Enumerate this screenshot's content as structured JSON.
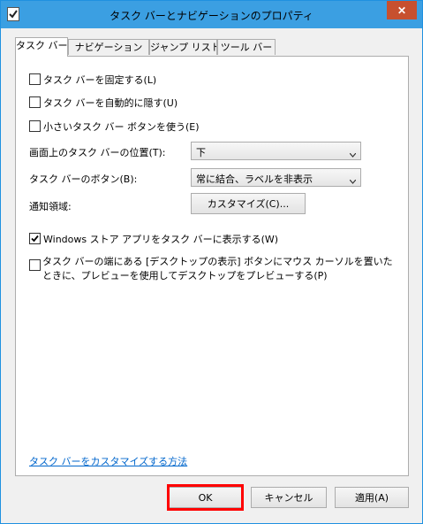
{
  "window": {
    "title": "タスク バーとナビゲーションのプロパティ",
    "close_glyph": "✕"
  },
  "tabs": [
    {
      "label": "タスク バー",
      "selected": true
    },
    {
      "label": "ナビゲーション",
      "selected": false
    },
    {
      "label": "ジャンプ リスト",
      "selected": false
    },
    {
      "label": "ツール バー",
      "selected": false
    }
  ],
  "taskbar": {
    "lock_taskbar": {
      "label": "タスク バーを固定する(L)",
      "checked": false
    },
    "auto_hide": {
      "label": "タスク バーを自動的に隠す(U)",
      "checked": false
    },
    "small_buttons": {
      "label": "小さいタスク バー ボタンを使う(E)",
      "checked": false
    },
    "position": {
      "label": "画面上のタスク バーの位置(T):",
      "value": "下"
    },
    "buttons": {
      "label": "タスク バーのボタン(B):",
      "value": "常に結合、ラベルを非表示"
    },
    "notification": {
      "label": "通知領域:",
      "button": "カスタマイズ(C)..."
    },
    "store_apps": {
      "label": "Windows ストア アプリをタスク バーに表示する(W)",
      "checked": true
    },
    "peek": {
      "label": "タスク バーの端にある [デスクトップの表示] ボタンにマウス カーソルを置いたときに、プレビューを使用してデスクトップをプレビューする(P)",
      "checked": false
    },
    "help_link": "タスク バーをカスタマイズする方法"
  },
  "buttons": {
    "ok": "OK",
    "cancel": "キャンセル",
    "apply": "適用(A)"
  },
  "highlight_color": "#ff0000"
}
